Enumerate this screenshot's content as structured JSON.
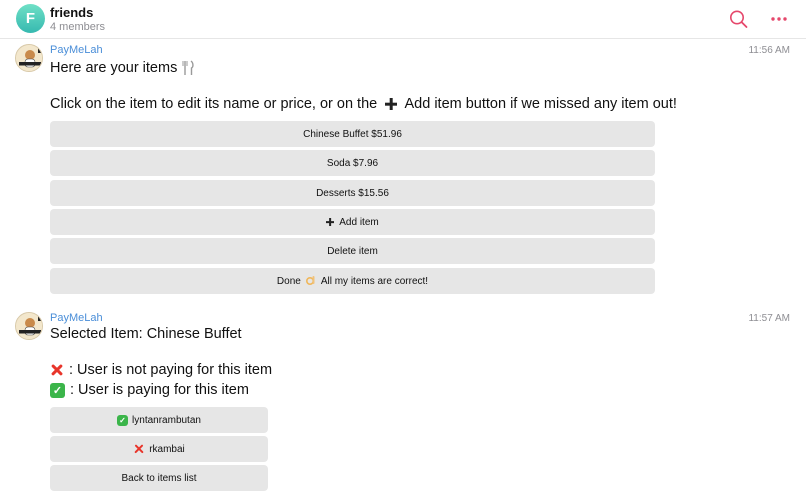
{
  "header": {
    "avatar_letter": "F",
    "title": "friends",
    "subtitle": "4 members",
    "icons": [
      "search-icon",
      "more-icon"
    ],
    "accent_color": "#e5476b"
  },
  "messages": [
    {
      "sender": "PayMeLah",
      "time": "11:56 AM",
      "lines": [
        "Here are your items",
        "Click on the item to edit its name or price, or on the",
        "Add item button if we missed any item out!"
      ],
      "buttons": [
        "Chinese Buffet $51.96",
        "Soda $7.96",
        "Desserts $15.56",
        "Add item",
        "Delete item",
        "All my items are correct!"
      ],
      "done_prefix": "Done"
    },
    {
      "sender": "PayMeLah",
      "time": "11:57 AM",
      "lines": [
        "Selected Item: Chinese Buffet",
        ": User is not paying for this item",
        ": User is paying for this item"
      ],
      "buttons": [
        "lyntanrambutan",
        "rkambai",
        "Back to items list"
      ]
    }
  ],
  "colors": {
    "sender_name": "#4a8ed8",
    "button_bg": "#e6e6e6",
    "cross": "#e8352b",
    "check": "#3bb54a"
  }
}
